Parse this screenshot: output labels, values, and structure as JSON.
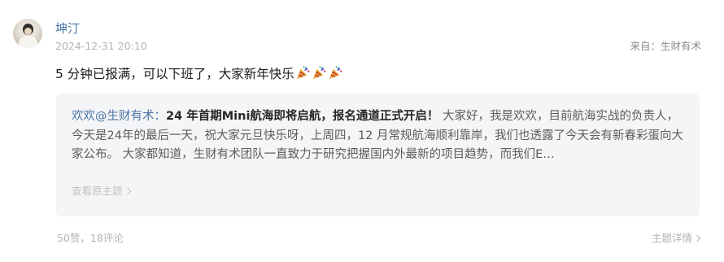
{
  "post": {
    "author": "坤汀",
    "timestamp": "2024-12-31 20:10",
    "source": "来自：生财有术",
    "message": "5 分钟已报满，可以下班了，大家新年快乐",
    "emoji_icons": [
      "party-popper-icon",
      "party-popper-icon",
      "party-popper-icon"
    ]
  },
  "quote": {
    "author": "欢欢@生财有术：",
    "title": "24 年首期Mini航海即将启航，报名通道正式开启！",
    "body": "  大家好，我是欢欢，目前航海实战的负责人，今天是24年的最后一天，祝大家元旦快乐呀，上周四，12 月常规航海顺利靠岸，我们也透露了今天会有新春彩蛋向大家公布。 大家都知道，生财有术团队一直致力于研究把握国内外最新的项目趋势，而我们E…",
    "link": "查看原主题"
  },
  "footer": {
    "stats": "50赞，18评论",
    "detail": "主题详情"
  },
  "colors": {
    "author_link": "#4b74a8",
    "quote_bg": "#f4f5f7",
    "muted": "#b3b3b3"
  }
}
